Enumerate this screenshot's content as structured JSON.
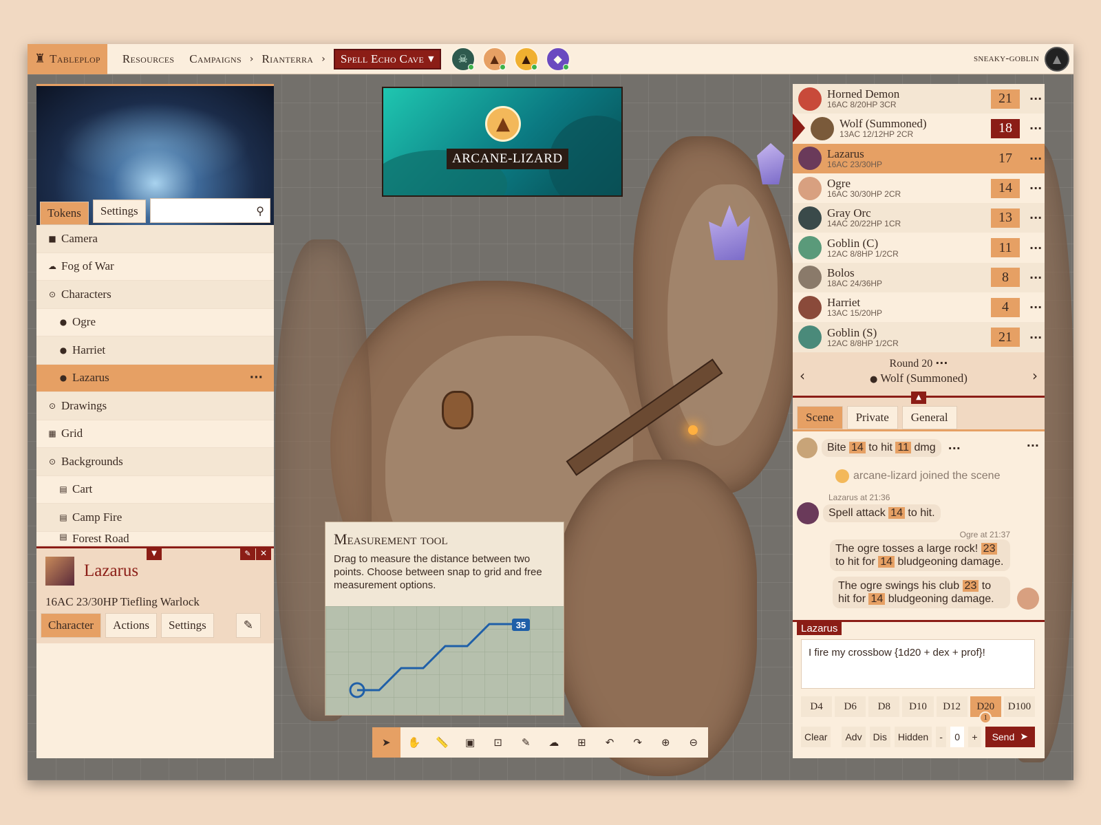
{
  "topbar": {
    "brand": "Tableplop",
    "nav": [
      "Resources",
      "Campaigns",
      "Rianterra"
    ],
    "scene": "Spell Echo Cave",
    "username": "sneaky-goblin"
  },
  "left": {
    "tabs": [
      "Tokens",
      "Settings"
    ],
    "search_placeholder": "",
    "tree": [
      {
        "icon": "camera-icon",
        "label": "Camera",
        "level": 0
      },
      {
        "icon": "fog-icon",
        "label": "Fog of War",
        "level": 0
      },
      {
        "icon": "chevron-down-icon",
        "label": "Characters",
        "level": 0
      },
      {
        "icon": "person-icon",
        "label": "Ogre",
        "level": 1
      },
      {
        "icon": "person-icon",
        "label": "Harriet",
        "level": 1
      },
      {
        "icon": "person-icon",
        "label": "Lazarus",
        "level": 1,
        "selected": true
      },
      {
        "icon": "chevron-right-icon",
        "label": "Drawings",
        "level": 0
      },
      {
        "icon": "grid-icon",
        "label": "Grid",
        "level": 0
      },
      {
        "icon": "chevron-down-icon",
        "label": "Backgrounds",
        "level": 0
      },
      {
        "icon": "image-icon",
        "label": "Cart",
        "level": 1
      },
      {
        "icon": "image-icon",
        "label": "Camp Fire",
        "level": 1
      },
      {
        "icon": "image-icon",
        "label": "Forest Road",
        "level": 1
      }
    ]
  },
  "character": {
    "name": "Lazarus",
    "summary": "16AC 23/30HP Tiefling Warlock",
    "tabs": [
      "Character",
      "Actions",
      "Settings"
    ]
  },
  "popup": {
    "name": "ARCANE-LIZARD"
  },
  "measure": {
    "title": "Measurement tool",
    "description": "Drag to measure the distance between two points. Choose between snap to grid and free measurement options.",
    "distance": "35"
  },
  "initiative": [
    {
      "name": "Horned Demon",
      "stats": "16AC 8/20HP 3CR",
      "score": "21",
      "color": "#c84a3a"
    },
    {
      "name": "Wolf (Summoned)",
      "stats": "13AC 12/12HP 2CR",
      "score": "18",
      "color": "#7a5a3a",
      "current": true
    },
    {
      "name": "Lazarus",
      "stats": "16AC 23/30HP",
      "score": "17",
      "color": "#6a3a5a",
      "selected": true
    },
    {
      "name": "Ogre",
      "stats": "16AC 30/30HP 2CR",
      "score": "14",
      "color": "#d8a080"
    },
    {
      "name": "Gray Orc",
      "stats": "14AC 20/22HP 1CR",
      "score": "13",
      "color": "#3a4a4a"
    },
    {
      "name": "Goblin (C)",
      "stats": "12AC 8/8HP 1/2CR",
      "score": "11",
      "color": "#5a9a7a"
    },
    {
      "name": "Bolos",
      "stats": "18AC 24/36HP",
      "score": "8",
      "color": "#8a7a6a"
    },
    {
      "name": "Harriet",
      "stats": "13AC 15/20HP",
      "score": "4",
      "color": "#8a4a3a"
    },
    {
      "name": "Goblin (S)",
      "stats": "12AC 8/8HP 1/2CR",
      "score": "21",
      "color": "#4a8a7a"
    }
  ],
  "round": {
    "label": "Round 20",
    "current": "Wolf (Summoned)"
  },
  "chat": {
    "tabs": [
      "Scene",
      "Private",
      "General"
    ],
    "m1": {
      "a": "Bite",
      "b": "14",
      "c": "to hit",
      "d": "11",
      "e": "dmg"
    },
    "join": "arcane-lizard joined the scene",
    "m2_meta": "Lazarus at 21:36",
    "m2": {
      "a": "Spell attack",
      "b": "14",
      "c": "to hit."
    },
    "m3_meta": "Ogre at 21:37",
    "m3": {
      "a": "The ogre tosses a large rock!",
      "b": "23",
      "c": "to hit for",
      "d": "14",
      "e": "bludgeoning damage."
    },
    "m4": {
      "a": "The ogre swings his club",
      "b": "23",
      "c": "to hit for",
      "d": "14",
      "e": "bludgeoning damage."
    },
    "speaker": "Lazarus",
    "input": "I fire my crossbow {1d20 + dex + prof}!",
    "dice": [
      "D4",
      "D6",
      "D8",
      "D10",
      "D12",
      "D20",
      "D100"
    ],
    "d20_count": "1",
    "controls": {
      "clear": "Clear",
      "adv": "Adv",
      "dis": "Dis",
      "hidden": "Hidden",
      "minus": "-",
      "mod": "0",
      "plus": "+",
      "send": "Send"
    }
  },
  "colors": {
    "accent": "#e6a064",
    "brand_red": "#8b1d16",
    "panel": "#fbeedd"
  }
}
